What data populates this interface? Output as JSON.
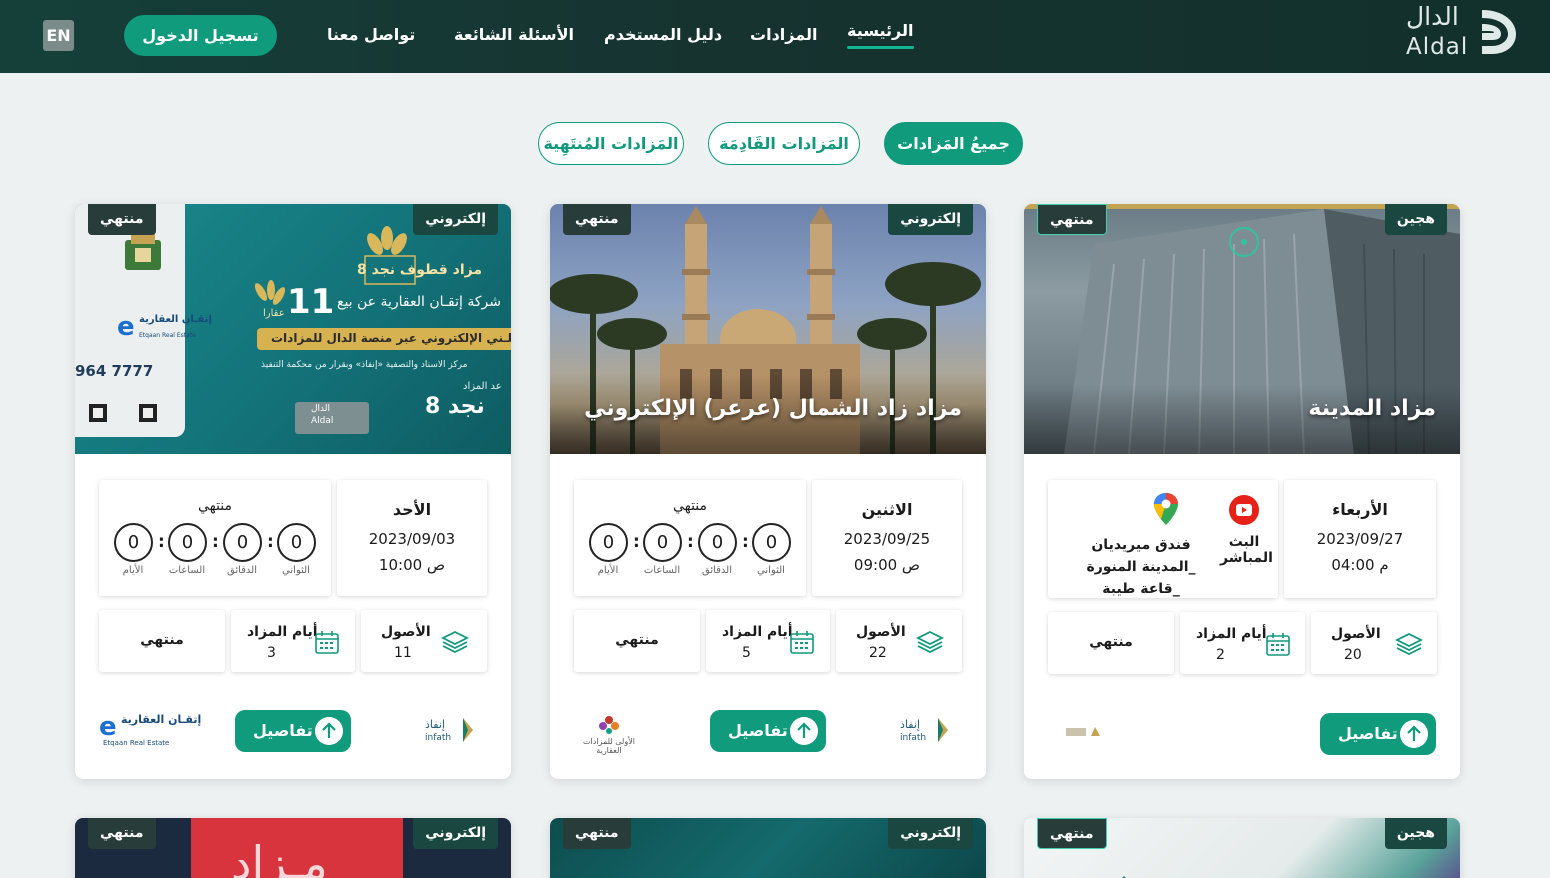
{
  "header": {
    "brand_ar": "الدال",
    "brand_en": "Aldal",
    "lang_button": "EN",
    "login_button": "تسجيل الدخول",
    "nav": [
      "الرئيسية",
      "المزادات",
      "دليل المستخدم",
      "الأسئلة الشائعة",
      "تواصل معنا"
    ],
    "active_nav": "الرئيسية"
  },
  "filters": {
    "all": "جميعُ المَزادات",
    "upcoming": "المَزادات القَادِمَة",
    "ended": "المَزادات المُنتَهِية",
    "active": "جميعُ المَزادات"
  },
  "colors": {
    "primary": "#0f9b7c",
    "header_bg": "#163330",
    "tag_bg": "#1a4740"
  },
  "cards": [
    {
      "type_tag": "هجين",
      "status_tag": "منتهي",
      "title": "مزاد المدينة",
      "day": "الأربعاء",
      "date": "2023/09/27",
      "time": "04:00 م",
      "live_label": "البث المباشر",
      "location": "فندق ميريديان _المدينة المنورة _قاعة طيبة",
      "assets_label": "الأصول",
      "assets_value": "20",
      "days_label": "أيام المزاد",
      "days_value": "2",
      "status_text": "منتهي",
      "details": "تفاصيل"
    },
    {
      "type_tag": "إلكتروني",
      "status_tag": "منتهي",
      "title": "مزاد زاد الشمال (عرعر) الإلكتروني",
      "day": "الاثنين",
      "date": "2023/09/25",
      "time": "09:00 ص",
      "countdown_status": "منتهي",
      "countdown": {
        "days": "0",
        "hours": "0",
        "minutes": "0",
        "seconds": "0"
      },
      "countdown_labels": {
        "days": "الأيام",
        "hours": "الساعات",
        "minutes": "الدقائق",
        "seconds": "الثواني"
      },
      "assets_label": "الأصول",
      "assets_value": "22",
      "days_label": "أيام المزاد",
      "days_value": "5",
      "status_text": "منتهي",
      "details": "تفاصيل",
      "partner": "الأولى للمزادات العقارية"
    },
    {
      "type_tag": "إلكتروني",
      "status_tag": "منتهي",
      "title": "",
      "banner": {
        "line1": "شركة إتقـان العقارية عن بيع",
        "big_number": "11",
        "unit": "عقارا",
        "line2": "علـني الإلكتروني عبر منصة الدال للمزادات",
        "line3": "مركز الاسناد والتصفية «إنفاذ» وبقرار من محكمة التنفيذ",
        "line4": "عد المزاد",
        "badge": "مزاد قطوف نجد 8",
        "name": "نجد 8",
        "phone": "964 7777",
        "company": "إتقـان العقارية",
        "company_en": "Etqaan Real Estate"
      },
      "day": "الأحد",
      "date": "2023/09/03",
      "time": "10:00 ص",
      "countdown_status": "منتهي",
      "countdown": {
        "days": "0",
        "hours": "0",
        "minutes": "0",
        "seconds": "0"
      },
      "countdown_labels": {
        "days": "الأيام",
        "hours": "الساعات",
        "minutes": "الدقائق",
        "seconds": "الثواني"
      },
      "assets_label": "الأصول",
      "assets_value": "11",
      "days_label": "أيام المزاد",
      "days_value": "3",
      "status_text": "منتهي",
      "details": "تفاصيل",
      "partner": "إتقـان العقارية",
      "partner_en": "Etqaan Real Estate"
    }
  ],
  "row2": [
    {
      "type_tag": "هجين",
      "status_tag": "منتهي"
    },
    {
      "type_tag": "إلكتروني",
      "status_tag": "منتهي"
    },
    {
      "type_tag": "إلكتروني",
      "status_tag": "منتهي",
      "banner_text": "مـزاد"
    }
  ],
  "infath": {
    "ar": "إنفاذ",
    "en": "infath"
  }
}
